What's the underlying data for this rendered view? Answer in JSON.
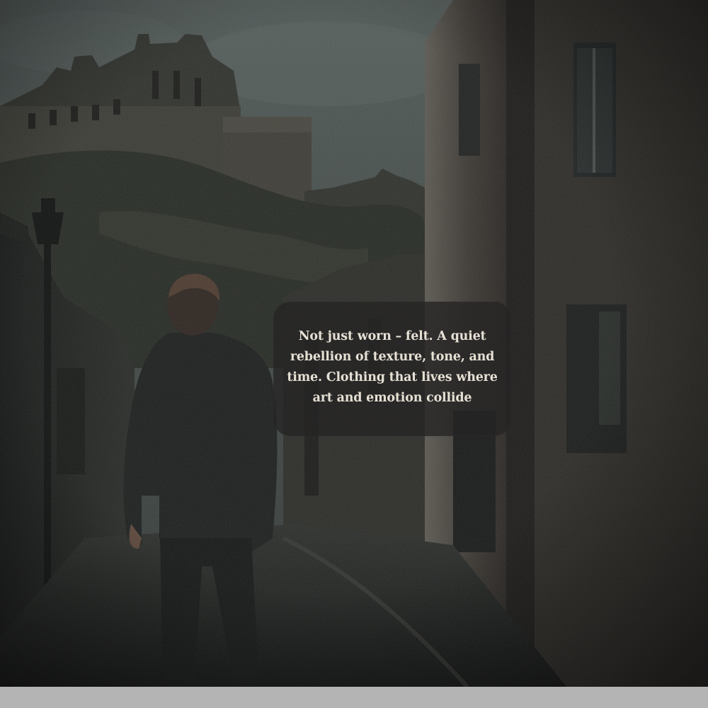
{
  "artwork": {
    "scene_name": "oil-painting-alley"
  },
  "caption": {
    "text": "Not just worn – felt. A quiet rebellion of texture, tone, and time. Clothing that lives where art and emotion collide"
  },
  "colors": {
    "sky": "#3f4745",
    "caption_background": "#262424",
    "caption_text": "#e6e0d4",
    "footer_bar": "#b4b4b4"
  }
}
